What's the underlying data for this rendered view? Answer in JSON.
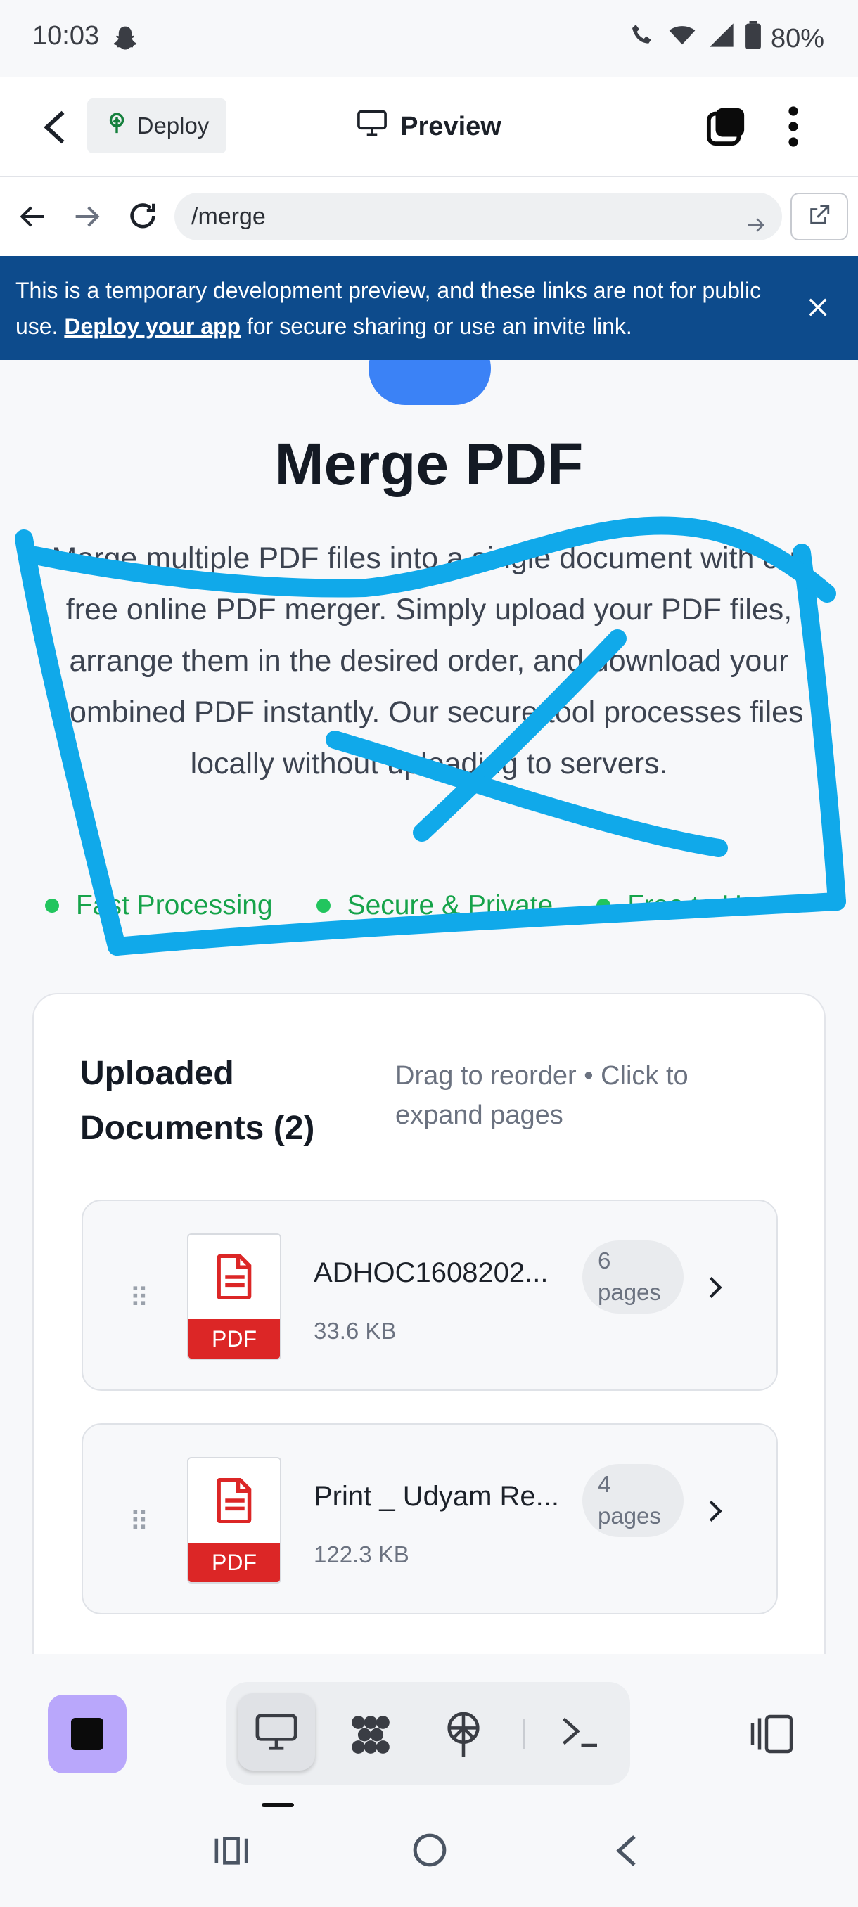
{
  "status_bar": {
    "time": "10:03",
    "battery": "80%"
  },
  "app_header": {
    "deploy_label": "Deploy",
    "preview_label": "Preview"
  },
  "url_bar": {
    "value": "/merge"
  },
  "banner": {
    "text_before": "This is a temporary development preview, and these links are not for public use.",
    "link_text": "Deploy your app",
    "text_after": "for secure sharing or use an invite link."
  },
  "page": {
    "title": "Merge PDF",
    "description": "Merge multiple PDF files into a single document with our free online PDF merger. Simply upload your PDF files, arrange them in the desired order, and download your combined PDF instantly. Our secure tool processes files locally without uploading to servers.",
    "features": [
      "Fast Processing",
      "Secure & Private",
      "Free to Use"
    ]
  },
  "documents_card": {
    "title": "Uploaded Documents (2)",
    "hint": "Drag to reorder • Click to expand pages",
    "files": [
      {
        "name": "ADHOC1608202...",
        "size": "33.6 KB",
        "pages_count": "6",
        "pages_word": "pages",
        "badge": "PDF"
      },
      {
        "name": "Print _ Udyam Re...",
        "size": "122.3 KB",
        "pages_count": "4",
        "pages_word": "pages",
        "badge": "PDF"
      }
    ]
  },
  "colors": {
    "banner_bg": "#0d4b8c",
    "accent_blue": "#3b82f6",
    "feature_green": "#16a34a",
    "pdf_red": "#dc2626",
    "stop_button": "#b9a7fb",
    "scribble": "#10a9ea"
  }
}
